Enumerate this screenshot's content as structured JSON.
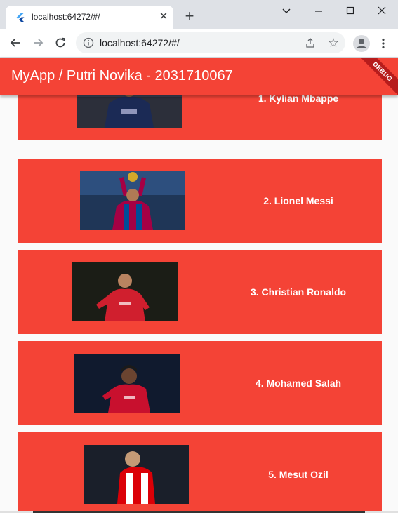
{
  "browser": {
    "tab_title": "localhost:64272/#/",
    "new_tab_glyph": "+",
    "close_glyph": "✕",
    "url": "localhost:64272/#/",
    "star_glyph": "☆"
  },
  "app": {
    "title": "MyApp / Putri Novika - 2031710067",
    "debug_banner": "DEBUG",
    "accent_color": "#f44336"
  },
  "players": [
    {
      "label": "1. Kylian Mbappe",
      "kit_color": "#1b2a55",
      "bg_color": "#2c2f3a"
    },
    {
      "label": "2. Lionel Messi",
      "kit_color": "#a50044",
      "bg_color": "#1f3657"
    },
    {
      "label": "3. Christian Ronaldo",
      "kit_color": "#d01f2e",
      "bg_color": "#1b1d16"
    },
    {
      "label": "4. Mohamed Salah",
      "kit_color": "#c8102e",
      "bg_color": "#101a2e"
    },
    {
      "label": "5. Mesut Ozil",
      "kit_color": "#db0007",
      "bg_color": "#1a1f2a"
    }
  ],
  "icons": [
    "flutter-icon",
    "close-icon",
    "plus-icon",
    "chevron-down-icon",
    "minimize-icon",
    "maximize-icon",
    "close-window-icon",
    "back-arrow-icon",
    "forward-arrow-icon",
    "reload-icon",
    "info-icon",
    "share-icon",
    "star-icon",
    "profile-icon",
    "kebab-menu-icon"
  ]
}
